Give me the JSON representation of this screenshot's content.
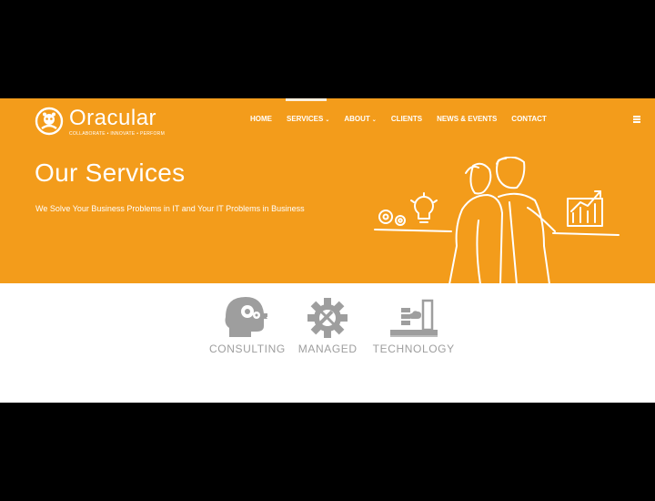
{
  "brand": {
    "name": "Oracular",
    "tagline": "COLLABORATE • INNOVATE • PERFORM"
  },
  "nav": {
    "items": [
      {
        "label": "HOME",
        "dropdown": false
      },
      {
        "label": "SERVICES",
        "dropdown": true,
        "active": true
      },
      {
        "label": "ABOUT",
        "dropdown": true
      },
      {
        "label": "CLIENTS",
        "dropdown": false
      },
      {
        "label": "NEWS & EVENTS",
        "dropdown": false
      },
      {
        "label": "CONTACT",
        "dropdown": false
      }
    ],
    "caret": "⌄",
    "menu_icon": "hamburger-icon"
  },
  "hero": {
    "title": "Our Services",
    "subtitle": "We Solve Your Business Problems in IT and Your IT Problems in Business"
  },
  "services": [
    {
      "label": "CONSULTING",
      "icon": "head-gears-icon"
    },
    {
      "label": "MANAGED",
      "icon": "gear-wrench-icon"
    },
    {
      "label": "TECHNOLOGY",
      "icon": "laptop-server-icon"
    }
  ],
  "colors": {
    "accent": "#f39c1b",
    "background": "#ffffff",
    "service_gray": "#9e9e9e",
    "letterbox": "#000000"
  }
}
